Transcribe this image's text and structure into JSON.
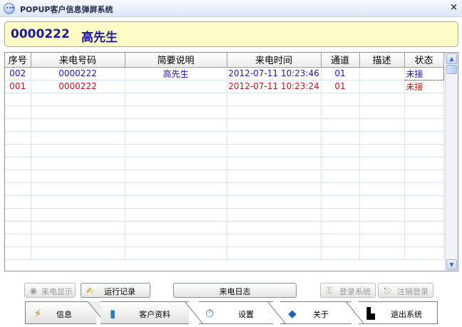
{
  "window": {
    "title": "POPUP客户信息弹屏系统",
    "close_glyph": "×"
  },
  "caller": {
    "number": "0000222",
    "name": "高先生"
  },
  "table": {
    "columns": [
      "序号",
      "来电号码",
      "简要说明",
      "来电时间",
      "通道",
      "描述",
      "状态"
    ],
    "rows": [
      {
        "seq": "002",
        "phone": "0000222",
        "summary": "高先生",
        "time": "2012-07-11 10:23:46",
        "channel": "01",
        "desc": "",
        "status": "未接",
        "color": "#1d1baa"
      },
      {
        "seq": "001",
        "phone": "0000222",
        "summary": "",
        "time": "2012-07-11 10:23:24",
        "channel": "01",
        "desc": "",
        "status": "未接",
        "color": "#c01818"
      }
    ]
  },
  "buttons": {
    "caller_display": "来电显示",
    "run_log": "运行记录",
    "call_log": "来电日志",
    "login": "登录系统",
    "logout": "注销登录"
  },
  "nav": {
    "info": "信息",
    "customer": "客户资料",
    "settings": "设置",
    "about": "关于",
    "exit": "退出系统"
  },
  "icons": {
    "app": "chat-bubble-icon",
    "caller_display": "circle-icon",
    "run_log": "pencil-icon",
    "login": "keys-icon",
    "logout": "logout-icon",
    "info": "magic-wand-icon",
    "customer": "door-icon",
    "settings": "stopwatch-icon",
    "about": "info-diamond-icon",
    "exit": "exit-door-icon"
  }
}
